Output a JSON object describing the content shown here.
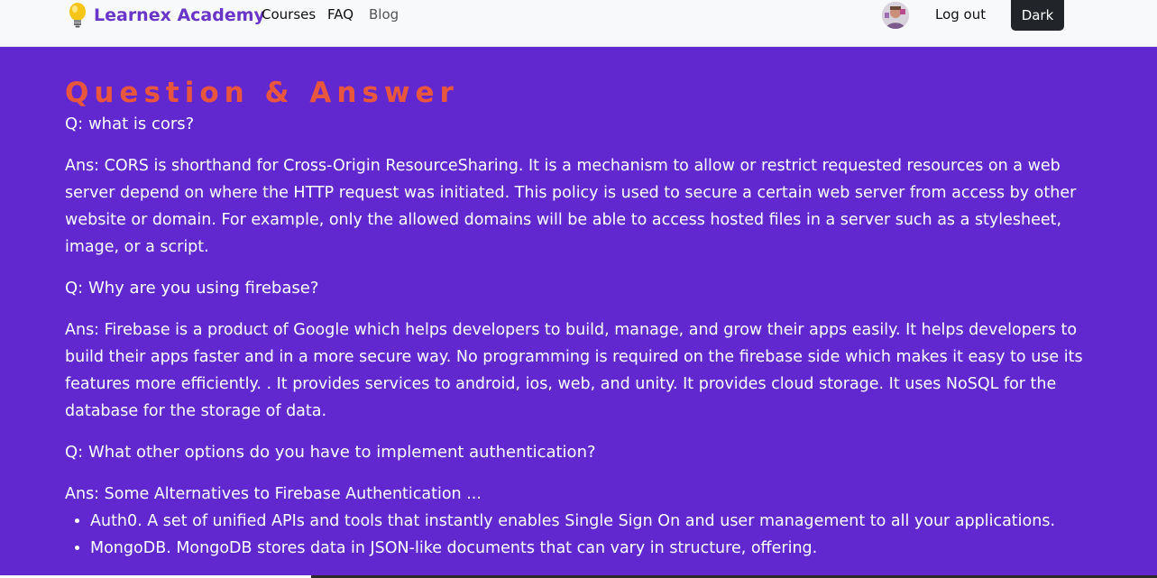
{
  "brand": {
    "name": "Learnex Academy",
    "logo_icon": "lightbulb-icon",
    "color": "#6a35c9"
  },
  "nav": {
    "courses": "Courses",
    "faq": "FAQ",
    "blog": "Blog"
  },
  "user": {
    "avatar_icon": "avatar-photo",
    "logout": "Log out",
    "theme_toggle": "Dark"
  },
  "page": {
    "title": "Question & Answer",
    "title_color": "#e8573d",
    "background": "#6228d0"
  },
  "qa": [
    {
      "question": "Q: what is cors?",
      "answer": "Ans: CORS is shorthand for Cross-Origin ResourceSharing. It is a mechanism to allow or restrict requested resources on a web server depend on where the HTTP request was initiated. This policy is used to secure a certain web server from access by other website or domain. For example, only the allowed domains will be able to access hosted files in a server such as a stylesheet, image, or a script."
    },
    {
      "question": "Q: Why are you using firebase?",
      "answer": "Ans: Firebase is a product of Google which helps developers to build, manage, and grow their apps easily. It helps developers to build their apps faster and in a more secure way. No programming is required on the firebase side which makes it easy to use its features more efficiently. . It provides services to android, ios, web, and unity. It provides cloud storage. It uses NoSQL for the database for the storage of data."
    },
    {
      "question": "Q: What other options do you have to implement authentication?",
      "answer": "Ans: Some Alternatives to Firebase Authentication ...",
      "list": [
        "Auth0. A set of unified APIs and tools that instantly enables Single Sign On and user management to all your applications.",
        "MongoDB. MongoDB stores data in JSON-like documents that can vary in structure, offering."
      ]
    }
  ]
}
